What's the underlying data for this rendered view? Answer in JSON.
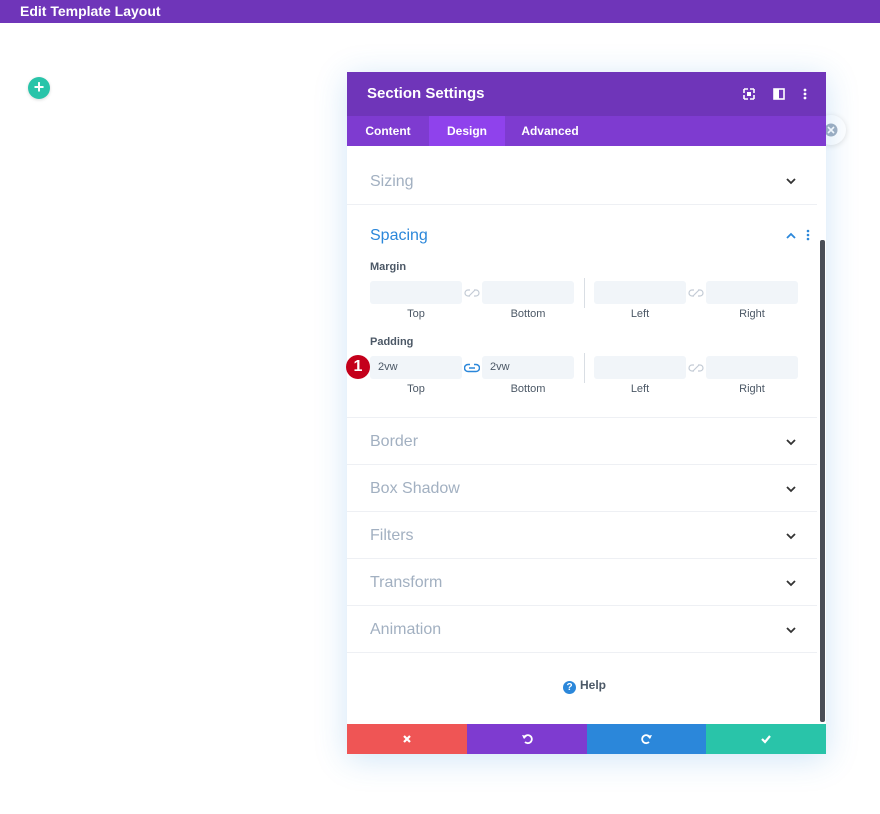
{
  "topbar": {
    "title": "Edit Template Layout"
  },
  "add_button": {
    "label": "+"
  },
  "modal": {
    "title": "Section Settings",
    "tabs": [
      {
        "label": "Content",
        "active": false
      },
      {
        "label": "Design",
        "active": true
      },
      {
        "label": "Advanced",
        "active": false
      }
    ],
    "sections": {
      "sizing": "Sizing",
      "spacing": "Spacing",
      "border": "Border",
      "box_shadow": "Box Shadow",
      "filters": "Filters",
      "transform": "Transform",
      "animation": "Animation"
    },
    "margin": {
      "label": "Margin",
      "top": "",
      "bottom": "",
      "left": "",
      "right": "",
      "sub_labels": {
        "top": "Top",
        "bottom": "Bottom",
        "left": "Left",
        "right": "Right"
      }
    },
    "padding": {
      "label": "Padding",
      "top": "2vw",
      "bottom": "2vw",
      "left": "",
      "right": "",
      "sub_labels": {
        "top": "Top",
        "bottom": "Bottom",
        "left": "Left",
        "right": "Right"
      }
    },
    "badge": "1",
    "help": "Help"
  },
  "colors": {
    "purple": "#6f35b9",
    "tab_purple": "#7e3bd0",
    "active_tab": "#8f42ec",
    "cancel_red": "#ef5555",
    "undo_purple": "#7e3bd0",
    "redo_blue": "#2b87da",
    "save_green": "#29c4a9",
    "accent_blue": "#2b87da",
    "badge_red": "#c4001b"
  }
}
